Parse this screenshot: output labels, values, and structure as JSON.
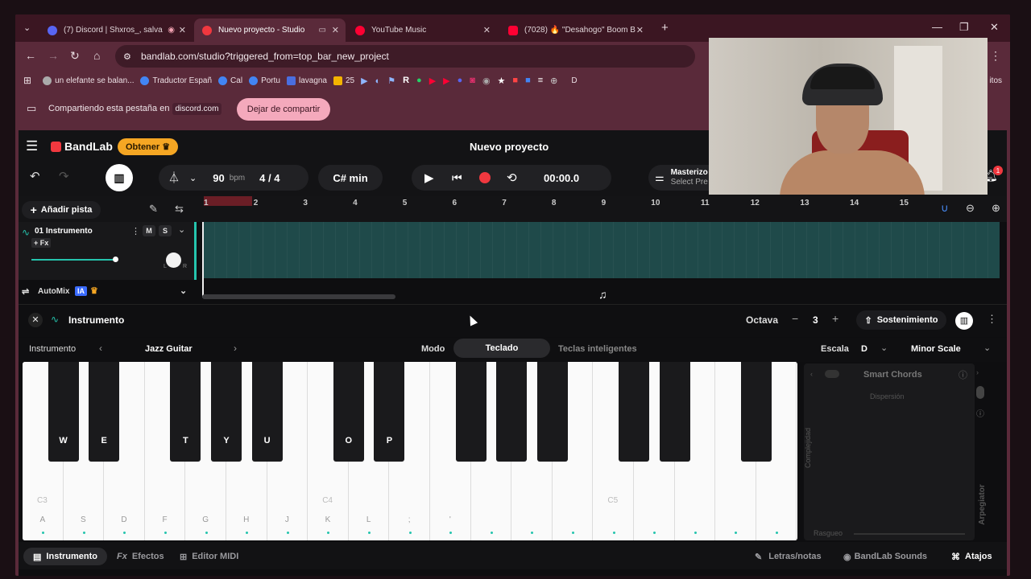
{
  "tabs": [
    {
      "title": "(7) Discord | Shxros_, salva",
      "fav": "#5865f2"
    },
    {
      "title": "Nuevo proyecto - Studio",
      "fav": "#f0383f"
    },
    {
      "title": "YouTube Music",
      "fav": "#ff0033"
    },
    {
      "title": "(7028) 🔥 \"Desahogo\" Boom B",
      "fav": "#ff0033"
    }
  ],
  "address": {
    "url": "bandlab.com/studio?triggered_from=top_bar_new_project"
  },
  "bookmarks": [
    {
      "label": "un elefante se balan...",
      "color": "#aaa"
    },
    {
      "label": "Traductor Españ",
      "color": "#4285f4"
    },
    {
      "label": "Cal",
      "color": "#4285f4"
    },
    {
      "label": "Portu",
      "color": "#4285f4"
    },
    {
      "label": "lavagna",
      "color": "#4a6ee0"
    },
    {
      "label": "25",
      "color": "#f4b400"
    }
  ],
  "bookmarks_tail": "D",
  "bookmarks_right": "itos",
  "share": {
    "text": "Compartiendo esta pestaña en",
    "domain": "discord.com",
    "button": "Dejar de compartir"
  },
  "app": {
    "logo": "BandLab",
    "get": "Obtener",
    "project_title": "Nuevo proyecto",
    "bpm_value": "90",
    "bpm_unit": "bpm",
    "time_signature": "4 / 4",
    "key": "C# min",
    "time": "00:00.0",
    "master_label": "Masterizo",
    "master_sub": "Select Pre",
    "notif_count": "1",
    "add_track": "Añadir pista",
    "ruler_ticks": [
      "1",
      "2",
      "3",
      "4",
      "5",
      "6",
      "7",
      "8",
      "9",
      "10",
      "11",
      "12",
      "13",
      "14",
      "15"
    ],
    "track": {
      "name": "01  Instrumento",
      "mute": "M",
      "solo": "S",
      "fx": "+ Fx",
      "pan_l": "L",
      "pan_r": "R"
    },
    "automix": {
      "label": "AutoMix",
      "badge": "IA"
    }
  },
  "panel": {
    "title": "Instrumento",
    "octave_label": "Octava",
    "octave_value": "3",
    "sustain": "Sostenimiento",
    "instrument_label": "Instrumento",
    "instrument_value": "Jazz Guitar",
    "mode_label": "Modo",
    "mode_active": "Teclado",
    "mode_other": "Teclas inteligentes",
    "scale_label": "Escala",
    "scale_key": "D",
    "scale_type": "Minor Scale"
  },
  "keys": {
    "white": [
      "A",
      "S",
      "D",
      "F",
      "G",
      "H",
      "J",
      "K",
      "L",
      ";",
      "'",
      "",
      "",
      "",
      "",
      "",
      "",
      "",
      "",
      ""
    ],
    "black": [
      "W",
      "E",
      "T",
      "Y",
      "U",
      "O",
      "P",
      "",
      "",
      "",
      "",
      "",
      "",
      ""
    ],
    "octaves": [
      "C3",
      "C4",
      "C5"
    ]
  },
  "chords": {
    "title": "Smart Chords",
    "dispersion": "Dispersión",
    "complexity": "Complejidad",
    "strum": "Rasgueo",
    "arp": "Arpegiator"
  },
  "bottom": {
    "instrument": "Instrumento",
    "effects": "Efectos",
    "midi": "Editor MIDI",
    "lyrics": "Letras/notas",
    "sounds": "BandLab Sounds",
    "shortcuts": "Atajos"
  }
}
